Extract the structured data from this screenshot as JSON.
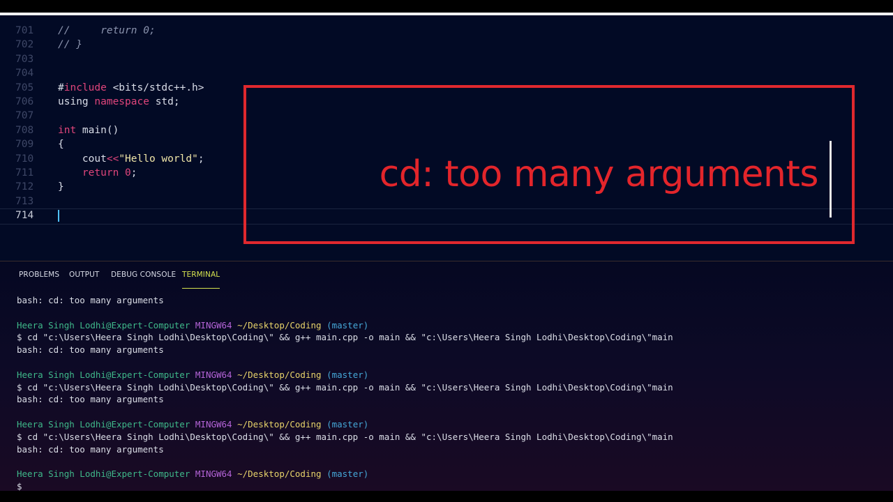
{
  "editor": {
    "lines": [
      {
        "num": "701",
        "parts": [
          {
            "c": "cm",
            "t": "//     return 0;"
          }
        ]
      },
      {
        "num": "702",
        "parts": [
          {
            "c": "cm",
            "t": "// }"
          }
        ]
      },
      {
        "num": "703",
        "parts": []
      },
      {
        "num": "704",
        "parts": []
      },
      {
        "num": "705",
        "parts": [
          {
            "c": "plain",
            "t": "#"
          },
          {
            "c": "kw",
            "t": "include"
          },
          {
            "c": "plain",
            "t": " <bits/stdc++.h>"
          }
        ]
      },
      {
        "num": "706",
        "parts": [
          {
            "c": "plain",
            "t": "using "
          },
          {
            "c": "kw",
            "t": "namespace"
          },
          {
            "c": "plain",
            "t": " std;"
          }
        ]
      },
      {
        "num": "707",
        "parts": []
      },
      {
        "num": "708",
        "parts": [
          {
            "c": "ty",
            "t": "int"
          },
          {
            "c": "plain",
            "t": " main()"
          }
        ]
      },
      {
        "num": "709",
        "parts": [
          {
            "c": "plain",
            "t": "{"
          }
        ]
      },
      {
        "num": "710",
        "parts": [
          {
            "c": "plain",
            "t": "    cout"
          },
          {
            "c": "op",
            "t": "<<"
          },
          {
            "c": "str",
            "t": "\"Hello world\""
          },
          {
            "c": "plain",
            "t": ";"
          }
        ]
      },
      {
        "num": "711",
        "parts": [
          {
            "c": "plain",
            "t": "    "
          },
          {
            "c": "kw",
            "t": "return"
          },
          {
            "c": "plain",
            "t": " "
          },
          {
            "c": "num",
            "t": "0"
          },
          {
            "c": "plain",
            "t": ";"
          }
        ]
      },
      {
        "num": "712",
        "parts": [
          {
            "c": "plain",
            "t": "}"
          }
        ]
      },
      {
        "num": "713",
        "parts": []
      },
      {
        "num": "714",
        "parts": [],
        "active": true
      }
    ]
  },
  "callout": {
    "text": "cd: too many arguments",
    "color": "#e0282e"
  },
  "panel": {
    "tabs": [
      "PROBLEMS",
      "OUTPUT",
      "DEBUG CONSOLE",
      "TERMINAL"
    ],
    "active_tab": "TERMINAL"
  },
  "terminal": {
    "error_line": "bash: cd: too many arguments",
    "user": "Heera Singh Lodhi@Expert-Computer",
    "system": "MINGW64",
    "cwd": "~/Desktop/Coding",
    "branch": "(master)",
    "command": "$ cd \"c:\\Users\\Heera Singh Lodhi\\Desktop\\Coding\\\" && g++ main.cpp -o main && \"c:\\Users\\Heera Singh Lodhi\\Desktop\\Coding\\\"main",
    "prompt": "$"
  }
}
